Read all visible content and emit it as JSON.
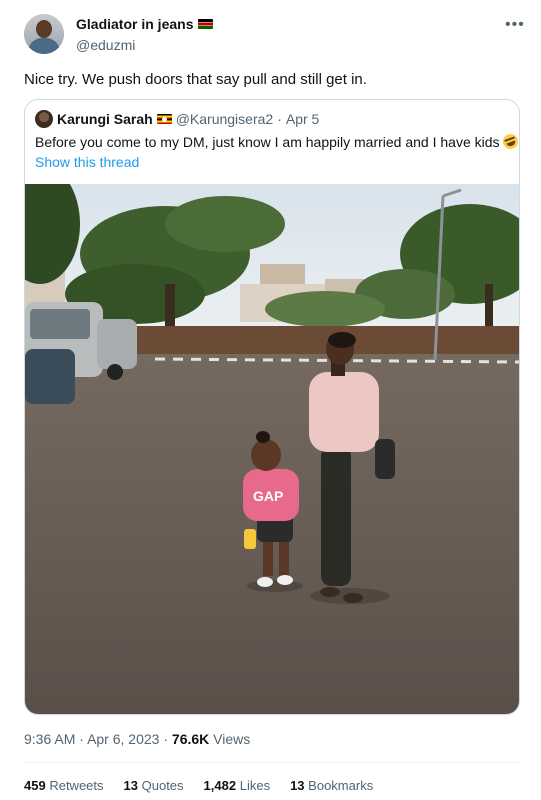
{
  "author": {
    "name": "Gladiator in jeans",
    "handle": "@eduzmi",
    "flag_icon": "kenya-flag-icon"
  },
  "menu_icon": "more-options-icon",
  "tweet": {
    "text": "Nice try. We push doors that say pull and still get in."
  },
  "quoted_tweet": {
    "name": "Karungi Sarah",
    "flag_icon": "uganda-flag-icon",
    "handle": "@Karungisera2",
    "separator": "·",
    "date": "Apr 5",
    "text": "Before you come to my DM, just know I am happily married and I have kids",
    "emoji": "rolling-on-floor-laughing-emoji",
    "show_thread": "Show this thread"
  },
  "meta": {
    "time": "9:36 AM",
    "separator": "·",
    "date": "Apr 6, 2023",
    "views_count": "76.6K",
    "views_label": "Views"
  },
  "stats": {
    "retweets_count": "459",
    "retweets_label": "Retweets",
    "quotes_count": "13",
    "quotes_label": "Quotes",
    "likes_count": "1,482",
    "likes_label": "Likes",
    "bookmarks_count": "13",
    "bookmarks_label": "Bookmarks"
  },
  "colors": {
    "link": "#1d9bf0",
    "secondary_text": "#536471",
    "border": "#cfd9de"
  }
}
